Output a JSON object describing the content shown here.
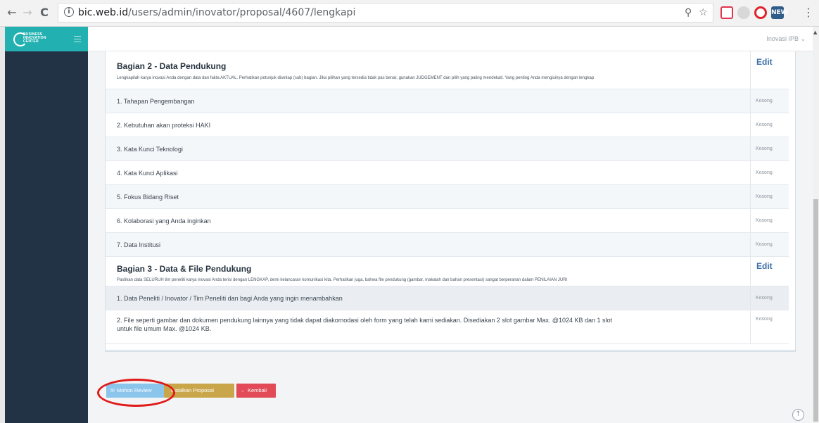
{
  "browser": {
    "back": "←",
    "forward": "→",
    "reload": "C",
    "info": "i",
    "url_host": "bic.web.id",
    "url_path": "/users/admin/inovator/proposal/4607/lengkapi",
    "zoom_icon": "⚲",
    "star_icon": "☆",
    "extensions": [
      "pocket-icon",
      "shield-icon",
      "opera-icon",
      "new-icon"
    ],
    "ext_new_label": "NEW",
    "menu_icon": "⋮"
  },
  "sidebar": {
    "logo_text": [
      "BUSINESS",
      "INNOVATION",
      "CENTER"
    ],
    "colors": {
      "bg": "#233346",
      "header": "#22b1b0"
    }
  },
  "topbar": {
    "user_menu": "Inovasi IPB ⌄"
  },
  "section2": {
    "title": "Bagian 2 - Data Pendukung",
    "desc": "Lengkapilah karya inovasi Anda dengan data dan fakta AKTUAL. Perhatikan petunjuk disetiap (sub) bagian. Jika pilihan yang tersedia tidak pas benar, gunakan JUDGEMENT dan pilih yang paling mendekati. Yang penting Anda mengisinya dengan lengkap",
    "edit": "Edit",
    "rows": [
      {
        "label": "1. Tahapan Pengembangan",
        "status": "Kosong"
      },
      {
        "label": "2. Kebutuhan akan proteksi HAKI",
        "status": "Kosong"
      },
      {
        "label": "3. Kata Kunci Teknologi",
        "status": "Kosong"
      },
      {
        "label": "4. Kata Kunci Aplikasi",
        "status": "Kosong"
      },
      {
        "label": "5. Fokus Bidang Riset",
        "status": "Kosong"
      },
      {
        "label": "6. Kolaborasi yang Anda inginkan",
        "status": "Kosong"
      },
      {
        "label": "7. Data Institusi",
        "status": "Kosong"
      }
    ]
  },
  "section3": {
    "title": "Bagian 3 - Data & File Pendukung",
    "desc": "Pastikan data SELURUH tim peneliti karya inovasi Anda terisi dengan LENGKAP, demi kelancaran komunikasi kita. Perhatikan juga, bahwa file pendukung (gambar, makalah dan bahan presentasi) sangat berperanan dalam PENILAIAN JURI",
    "edit": "Edit",
    "rows": [
      {
        "label": "1. Data Peneliti / Inovator / Tim Peneliti dan bagi Anda yang ingin menambahkan",
        "status": "Kosong"
      },
      {
        "label_line1": "2. File seperti gambar dan dokumen pendukung lainnya yang tidak dapat diakomodasi oleh form yang telah kami sediakan. Disediakan 2 slot gambar Max. @1024 KB dan 1 slot",
        "label_line2": "untuk file umum Max. @1024 KB.",
        "status": "Kosong"
      }
    ]
  },
  "actions": {
    "review": "Mohon Review",
    "review_icon": "✉",
    "batal": "Batalkan Proposal",
    "kembali": "Kembali",
    "kembali_icon": "←",
    "colors": {
      "review": "#8bc5ec",
      "batal": "#c9a649",
      "kembali": "#e14a56",
      "annotation": "#e01919"
    }
  },
  "to_top_icon": "↑"
}
